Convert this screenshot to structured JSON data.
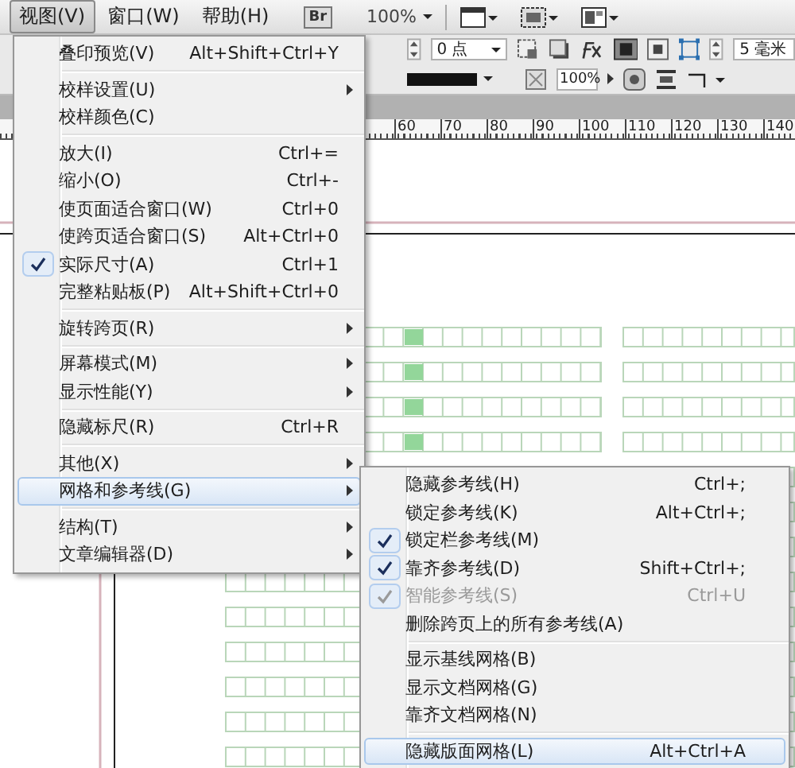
{
  "menubar": {
    "items": [
      {
        "label": "视图(V)",
        "selected": true
      },
      {
        "label": "窗口(W)",
        "selected": false
      },
      {
        "label": "帮助(H)",
        "selected": false
      }
    ],
    "bridge_button": "Br",
    "zoom": "100%"
  },
  "control_panel": {
    "stroke_weight": "0 点",
    "opacity": "100%",
    "offset": "5 毫米"
  },
  "ruler": {
    "labels": [
      "60",
      "70",
      "80",
      "90",
      "100",
      "110",
      "120",
      "130",
      "140"
    ]
  },
  "menus": [
    {
      "items": [
        {
          "kind": "item",
          "label": "叠印预览(V)",
          "shortcut": "Alt+Shift+Ctrl+Y",
          "submenu": false,
          "checked": false,
          "disabled": false,
          "highlighted": false
        },
        {
          "kind": "separator"
        },
        {
          "kind": "item",
          "label": "校样设置(U)",
          "submenu": true,
          "checked": false,
          "disabled": false,
          "highlighted": false
        },
        {
          "kind": "item",
          "label": "校样颜色(C)",
          "submenu": false,
          "checked": false,
          "disabled": false,
          "highlighted": false
        },
        {
          "kind": "separator"
        },
        {
          "kind": "item",
          "label": "放大(I)",
          "shortcut": "Ctrl+=",
          "submenu": false,
          "checked": false,
          "disabled": false,
          "highlighted": false
        },
        {
          "kind": "item",
          "label": "缩小(O)",
          "shortcut": "Ctrl+-",
          "submenu": false,
          "checked": false,
          "disabled": false,
          "highlighted": false
        },
        {
          "kind": "item",
          "label": "使页面适合窗口(W)",
          "shortcut": "Ctrl+0",
          "submenu": false,
          "checked": false,
          "disabled": false,
          "highlighted": false
        },
        {
          "kind": "item",
          "label": "使跨页适合窗口(S)",
          "shortcut": "Alt+Ctrl+0",
          "submenu": false,
          "checked": false,
          "disabled": false,
          "highlighted": false
        },
        {
          "kind": "item",
          "label": "实际尺寸(A)",
          "shortcut": "Ctrl+1",
          "submenu": false,
          "checked": true,
          "disabled": false,
          "highlighted": false
        },
        {
          "kind": "item",
          "label": "完整粘贴板(P)",
          "shortcut": "Alt+Shift+Ctrl+0",
          "submenu": false,
          "checked": false,
          "disabled": false,
          "highlighted": false
        },
        {
          "kind": "separator"
        },
        {
          "kind": "item",
          "label": "旋转跨页(R)",
          "submenu": true,
          "checked": false,
          "disabled": false,
          "highlighted": false
        },
        {
          "kind": "separator"
        },
        {
          "kind": "item",
          "label": "屏幕模式(M)",
          "submenu": true,
          "checked": false,
          "disabled": false,
          "highlighted": false
        },
        {
          "kind": "item",
          "label": "显示性能(Y)",
          "submenu": true,
          "checked": false,
          "disabled": false,
          "highlighted": false
        },
        {
          "kind": "separator"
        },
        {
          "kind": "item",
          "label": "隐藏标尺(R)",
          "shortcut": "Ctrl+R",
          "submenu": false,
          "checked": false,
          "disabled": false,
          "highlighted": false
        },
        {
          "kind": "separator"
        },
        {
          "kind": "item",
          "label": "其他(X)",
          "submenu": true,
          "checked": false,
          "disabled": false,
          "highlighted": false
        },
        {
          "kind": "item",
          "label": "网格和参考线(G)",
          "submenu": true,
          "checked": false,
          "disabled": false,
          "highlighted": true
        },
        {
          "kind": "separator"
        },
        {
          "kind": "item",
          "label": "结构(T)",
          "submenu": true,
          "checked": false,
          "disabled": false,
          "highlighted": false
        },
        {
          "kind": "item",
          "label": "文章编辑器(D)",
          "submenu": true,
          "checked": false,
          "disabled": false,
          "highlighted": false
        }
      ]
    },
    {
      "items": [
        {
          "kind": "item",
          "label": "隐藏参考线(H)",
          "shortcut": "Ctrl+;",
          "submenu": false,
          "checked": false,
          "disabled": false,
          "highlighted": false
        },
        {
          "kind": "item",
          "label": "锁定参考线(K)",
          "shortcut": "Alt+Ctrl+;",
          "submenu": false,
          "checked": false,
          "disabled": false,
          "highlighted": false
        },
        {
          "kind": "item",
          "label": "锁定栏参考线(M)",
          "submenu": false,
          "checked": true,
          "disabled": false,
          "highlighted": false
        },
        {
          "kind": "item",
          "label": "靠齐参考线(D)",
          "shortcut": "Shift+Ctrl+;",
          "submenu": false,
          "checked": true,
          "disabled": false,
          "highlighted": false
        },
        {
          "kind": "item",
          "label": "智能参考线(S)",
          "shortcut": "Ctrl+U",
          "submenu": false,
          "checked": true,
          "disabled": true,
          "highlighted": false
        },
        {
          "kind": "item",
          "label": "删除跨页上的所有参考线(A)",
          "submenu": false,
          "checked": false,
          "disabled": false,
          "highlighted": false
        },
        {
          "kind": "separator"
        },
        {
          "kind": "item",
          "label": "显示基线网格(B)",
          "submenu": false,
          "checked": false,
          "disabled": false,
          "highlighted": false
        },
        {
          "kind": "item",
          "label": "显示文档网格(G)",
          "submenu": false,
          "checked": false,
          "disabled": false,
          "highlighted": false
        },
        {
          "kind": "item",
          "label": "靠齐文档网格(N)",
          "submenu": false,
          "checked": false,
          "disabled": false,
          "highlighted": false
        },
        {
          "kind": "separator"
        },
        {
          "kind": "item",
          "label": "隐藏版面网格(L)",
          "shortcut": "Alt+Ctrl+A",
          "submenu": false,
          "checked": false,
          "disabled": false,
          "highlighted": true
        }
      ]
    }
  ]
}
